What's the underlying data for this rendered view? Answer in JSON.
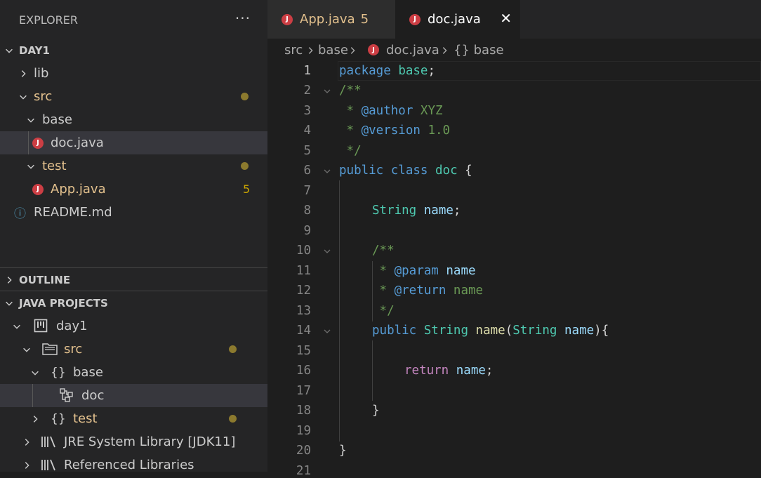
{
  "explorer": {
    "title": "EXPLORER",
    "more": "···",
    "workspace": "DAY1",
    "tree": [
      {
        "label": "lib"
      },
      {
        "label": "src"
      },
      {
        "label": "base"
      },
      {
        "label": "doc.java",
        "icon": "J"
      },
      {
        "label": "test"
      },
      {
        "label": "App.java",
        "icon": "J",
        "count": "5"
      },
      {
        "label": "README.md",
        "icon": "ⓘ"
      }
    ]
  },
  "outline": {
    "title": "OUTLINE"
  },
  "java_projects": {
    "title": "JAVA PROJECTS",
    "items": [
      {
        "label": "day1"
      },
      {
        "label": "src"
      },
      {
        "label": "base",
        "icon": "{}"
      },
      {
        "label": "doc"
      },
      {
        "label": "test",
        "icon": "{}"
      },
      {
        "label": "JRE System Library [JDK11]"
      },
      {
        "label": "Referenced Libraries"
      }
    ]
  },
  "tabs": [
    {
      "label": "App.java",
      "badge": "5",
      "icon": "J"
    },
    {
      "label": "doc.java",
      "icon": "J",
      "close": "✕"
    }
  ],
  "breadcrumb": {
    "p1": "src",
    "p2": "base",
    "p3": "doc.java",
    "p4": "{} base"
  },
  "editor": {
    "line_numbers": [
      "1",
      "2",
      "3",
      "4",
      "5",
      "6",
      "7",
      "8",
      "9",
      "10",
      "11",
      "12",
      "13",
      "14",
      "15",
      "16",
      "17",
      "18",
      "19",
      "20",
      "21"
    ],
    "code": {
      "l1": [
        "package",
        " ",
        "base",
        ";"
      ],
      "l2": [
        "/**"
      ],
      "l3": [
        " * ",
        "@author",
        " XYZ"
      ],
      "l4": [
        " * ",
        "@version",
        " 1.0"
      ],
      "l5": [
        " */"
      ],
      "l6": [
        "public",
        " ",
        "class",
        " ",
        "doc",
        " {"
      ],
      "l8": [
        "String",
        " ",
        "name",
        ";"
      ],
      "l10": [
        "/**"
      ],
      "l11": [
        " * ",
        "@param",
        " ",
        "name"
      ],
      "l12": [
        " * ",
        "@return",
        " name"
      ],
      "l13": [
        " */"
      ],
      "l14": [
        "public",
        " ",
        "String",
        " ",
        "name",
        "(",
        "String",
        " ",
        "name",
        "){"
      ],
      "l16": [
        "return",
        " ",
        "name",
        ";"
      ],
      "l18": [
        "}"
      ],
      "l20": [
        "}"
      ]
    }
  },
  "colors": {
    "keyword": "#569cd6",
    "type": "#4ec9b0",
    "variable": "#9cdcfe",
    "function": "#dcdcaa",
    "comment": "#6a9955",
    "control": "#c586c0",
    "java_icon": "#cc3e44",
    "modified": "#e2c08d"
  }
}
